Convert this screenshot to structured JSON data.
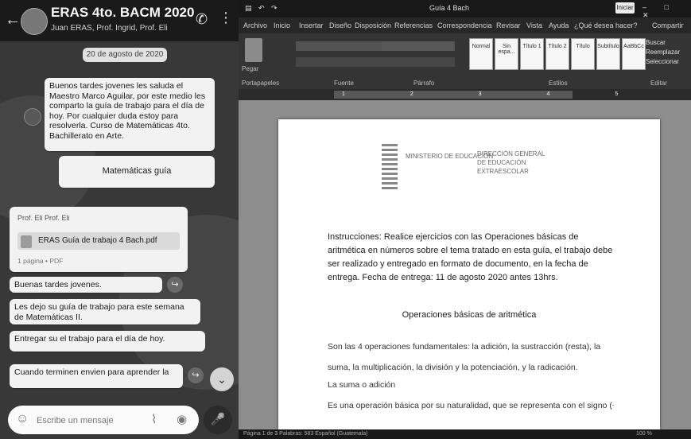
{
  "chat": {
    "title": "ERAS 4to. BACM 2020",
    "subtitle": "Juan ERAS, Prof. Ingrid, Prof. Eli",
    "date_chip": "20 de agosto de 2020",
    "messages": [
      {
        "text": "Buenos tardes jovenes les saluda el Maestro Marco Aguilar, por este medio les comparto la guía de trabajo para el día de hoy. Por cualquier duda estoy para resolverla. Curso de Matemáticas 4to. Bachillerato en Arte.",
        "time": ""
      },
      {
        "text": "Matemáticas guía"
      },
      {
        "header": "Prof. Eli Prof. Eli",
        "file": "ERAS Guía de trabajo 4 Bach.pdf",
        "meta": "1 página • PDF"
      },
      {
        "text": "Buenas tardes jovenes.",
        "time": ""
      },
      {
        "text": "Les dejo su guía de trabajo para este semana de Matemáticas II."
      },
      {
        "text": "Entregar su el trabajo para el día de hoy."
      },
      {
        "text": "Cuando terminen envien para aprender la"
      }
    ],
    "compose_placeholder": "Escribe un mensaje",
    "scroll_icon": "⌄",
    "mic_icon": "🎤"
  },
  "word": {
    "doc_title": "Guía 4 Bach",
    "login_label": "Iniciar",
    "menu": [
      "Archivo",
      "Inicio",
      "Insertar",
      "Diseño",
      "Disposición",
      "Referencias",
      "Correspondencia",
      "Revisar",
      "Vista",
      "Ayuda",
      "¿Qué desea hacer?",
      "Compartir"
    ],
    "ribbon_labels": {
      "paste": "Pegar",
      "clipboard": "Portapapeles",
      "font": "Fuente",
      "paragraph": "Párrafo",
      "styles": "Estilos",
      "edit": "Editar"
    },
    "styles": [
      "Normal",
      "Sin espa...",
      "Título 1",
      "Título 2",
      "Título",
      "Subtítulo",
      "AaBbCc"
    ],
    "edit_items": [
      "Buscar",
      "Reemplazar",
      "Seleccionar"
    ],
    "ruler_labels": "1 2 3 4 5",
    "logo": {
      "org1": "MINISTERIO DE EDUCACIÓN",
      "org2_line1": "DIRECCIÓN GENERAL",
      "org2_line2": "DE EDUCACIÓN EXTRAESCOLAR"
    },
    "instructions": "Instrucciones: Realice ejercicios con las Operaciones básicas de aritmética en números sobre el tema tratado en esta guía, el trabajo debe ser realizado y entregado en formato de documento, en la fecha de entrega. Fecha de entrega: 11 de agosto 2020 antes 13hrs.",
    "section_title": "Operaciones básicas de aritmética",
    "body_lines": [
      "Son las 4 operaciones fundamentales: la adición, la sustracción (resta), la",
      "suma, la multiplicación, la división y la potenciación, y la radicación.",
      "La suma o adición",
      "Es una operación básica por su naturalidad, que se representa con el signo (+), se"
    ],
    "status": "Página 1 de 3   Palabras: 583   Español (Guatemala)",
    "zoom": "100 %"
  }
}
